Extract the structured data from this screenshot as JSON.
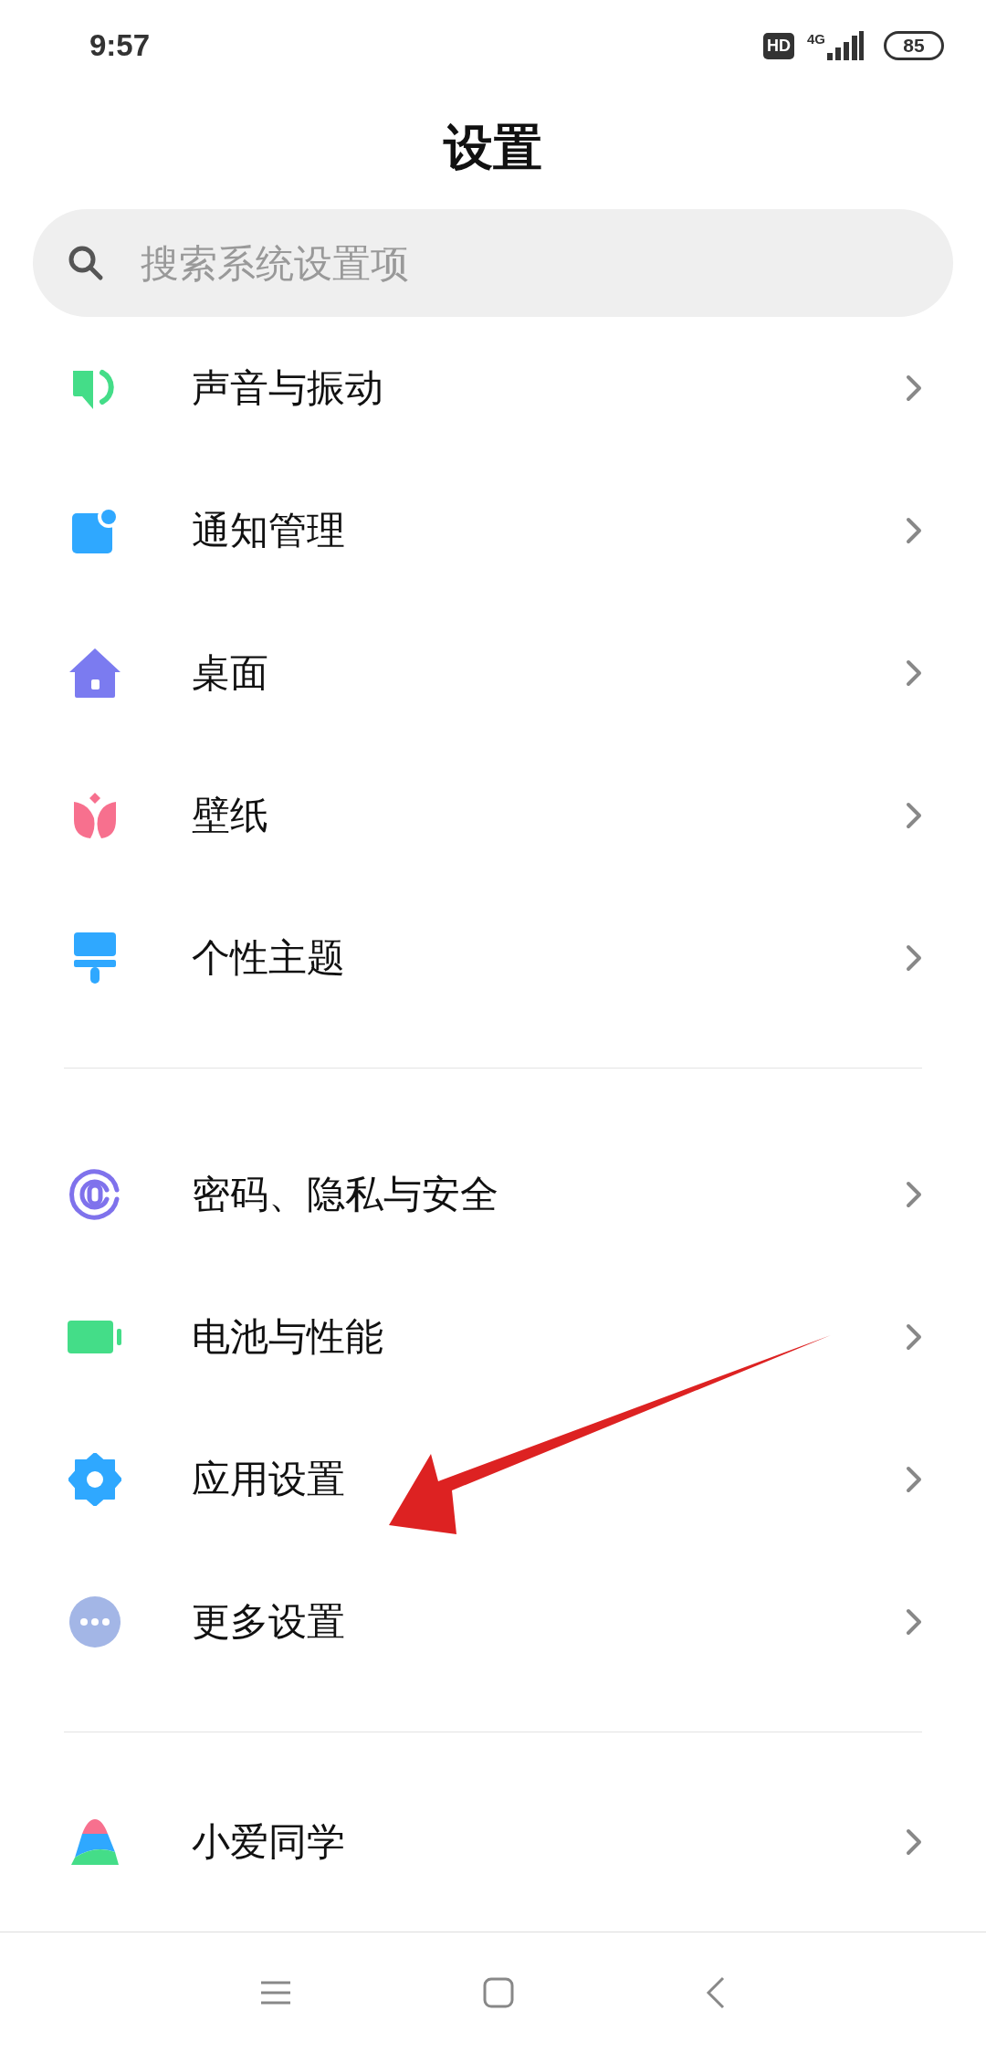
{
  "status_bar": {
    "time": "9:57",
    "hd": "HD",
    "network": "4G",
    "battery": "85"
  },
  "title": "设置",
  "search": {
    "placeholder": "搜索系统设置项"
  },
  "groups": [
    {
      "items": [
        {
          "label": "声音与振动"
        },
        {
          "label": "通知管理"
        },
        {
          "label": "桌面"
        },
        {
          "label": "壁纸"
        },
        {
          "label": "个性主题"
        }
      ]
    },
    {
      "items": [
        {
          "label": "密码、隐私与安全"
        },
        {
          "label": "电池与性能"
        },
        {
          "label": "应用设置"
        },
        {
          "label": "更多设置"
        }
      ]
    },
    {
      "items": [
        {
          "label": "小爱同学"
        }
      ]
    }
  ],
  "annotation": {
    "kind": "arrow"
  }
}
